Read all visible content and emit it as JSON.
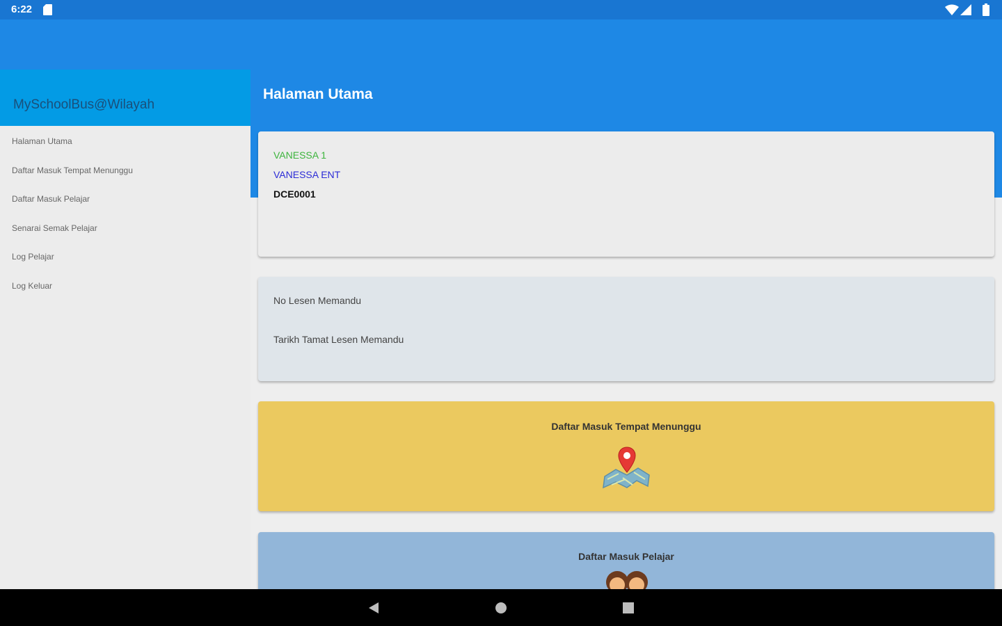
{
  "status_bar": {
    "time": "6:22"
  },
  "app": {
    "name": "MySchoolBus@Wilayah",
    "page_title": "Halaman Utama"
  },
  "drawer": {
    "items": [
      {
        "label": "Halaman Utama"
      },
      {
        "label": "Daftar Masuk Tempat Menunggu"
      },
      {
        "label": "Daftar Masuk Pelajar"
      },
      {
        "label": "Senarai Semak Pelajar"
      },
      {
        "label": "Log Pelajar"
      },
      {
        "label": "Log Keluar"
      }
    ]
  },
  "profile": {
    "name": "VANESSA 1",
    "company": "VANESSA ENT",
    "code": "DCE0001"
  },
  "license": {
    "label_number": "No Lesen Memandu",
    "label_expiry": "Tarikh Tamat Lesen Memandu"
  },
  "cards": {
    "waiting": {
      "label": "Daftar Masuk Tempat Menunggu"
    },
    "student": {
      "label": "Daftar Masuk Pelajar"
    }
  },
  "colors": {
    "app_bar": "#1e88e5",
    "status_bar": "#1976d2",
    "drawer_header": "#039be5",
    "waiting_card": "#ebc95f",
    "student_card": "#92b6d9",
    "profile_name": "#3cb43c",
    "profile_company": "#2a2ad6"
  },
  "icons": {
    "status": [
      "sd-card-icon",
      "wifi-icon",
      "cell-signal-icon",
      "battery-icon"
    ],
    "cards": [
      "map-pin-icon",
      "students-icon"
    ],
    "nav": [
      "back-icon",
      "home-icon",
      "recent-apps-icon"
    ]
  }
}
